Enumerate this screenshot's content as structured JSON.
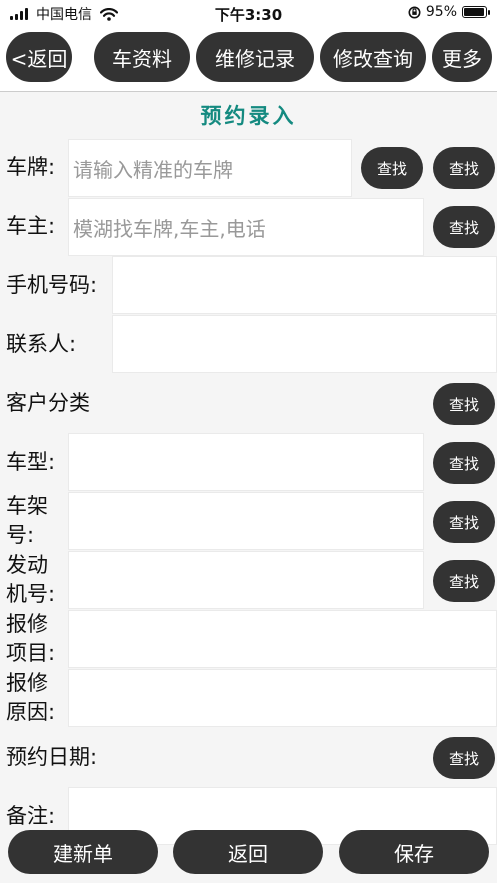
{
  "status_bar": {
    "carrier": "中国电信",
    "time": "下午3:30",
    "battery": "95%",
    "battery_level": 0.95
  },
  "nav": {
    "back": "<返回",
    "car_info": "车资料",
    "repair_records": "维修记录",
    "modify_query": "修改查询",
    "more": "更多"
  },
  "form": {
    "title": "预约录入",
    "plate_label": "车牌:",
    "plate_placeholder": "请输入精准的车牌",
    "owner_label": "车主:",
    "owner_placeholder": "模湖找车牌,车主,电话",
    "phone_label": "手机号码:",
    "contact_label": "联系人:",
    "customer_type_label": "客户分类",
    "model_label": "车型:",
    "vin_label_1": "车架",
    "vin_label_2": "号:",
    "engine_label_1": "发动",
    "engine_label_2": "机号:",
    "repair_items_label_1": "报修",
    "repair_items_label_2": "项目:",
    "repair_reason_label_1": "报修",
    "repair_reason_label_2": "原因:",
    "date_label": "预约日期:",
    "remark_label": "备注:",
    "search": "查找"
  },
  "bottom": {
    "new_order": "建新单",
    "back": "返回",
    "save": "保存"
  }
}
